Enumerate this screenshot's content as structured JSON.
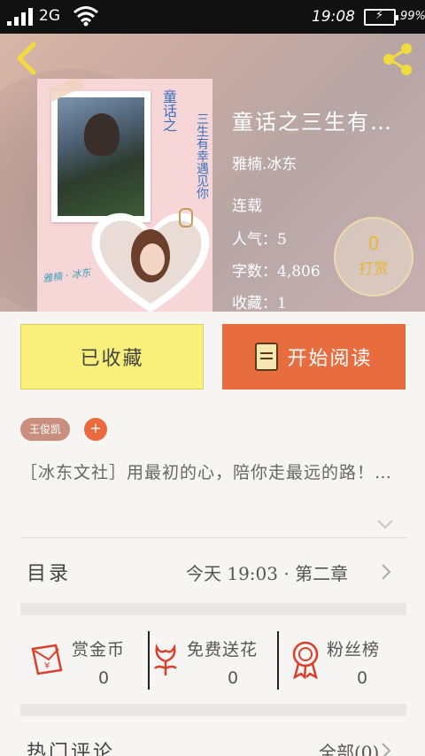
{
  "status_bar": {
    "network": "2G",
    "time": "19:08",
    "battery": "99%"
  },
  "book": {
    "title": "童话之三生有…",
    "author": "雅楠.冰东",
    "status": "连载",
    "popularity": "人气：5",
    "word_count": "字数：4,806",
    "favorites": "收藏：1",
    "cover_text": {
      "title": "童话之",
      "subtitle": "三生有幸遇见你",
      "signature": "雅楠 · 冰东"
    }
  },
  "reward": {
    "count": "0",
    "label": "打赏"
  },
  "actions": {
    "collected_label": "已收藏",
    "read_label": "开始阅读"
  },
  "tags": [
    {
      "label": "王俊凯"
    }
  ],
  "tag_add_label": "+",
  "description": "［冰东文社］用最初的心，陪你走最远的路！…",
  "toc": {
    "label": "目录",
    "latest": "今天 19:03 · 第二章"
  },
  "stats": [
    {
      "name": "赏金币",
      "value": "0",
      "icon": "red-envelope-icon"
    },
    {
      "name": "免费送花",
      "value": "0",
      "icon": "flower-icon"
    },
    {
      "name": "粉丝榜",
      "value": "0",
      "icon": "medal-icon"
    }
  ],
  "comments": {
    "label": "热门评论",
    "all": "全部(0)"
  },
  "colors": {
    "accent": "#e76d3e",
    "collected_bg": "#f8f07a",
    "tag": "#c98e7e",
    "reward": "#e7b63a"
  }
}
